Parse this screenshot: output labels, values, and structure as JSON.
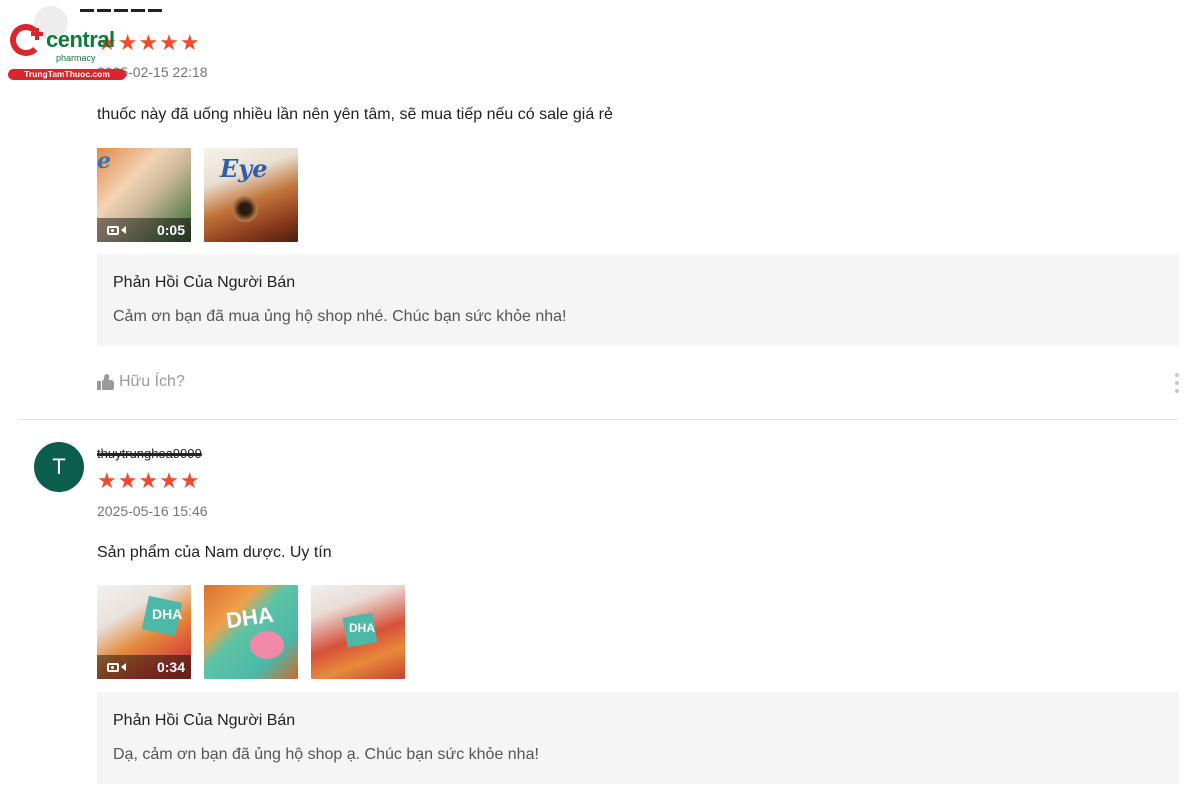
{
  "brand": {
    "name": "central",
    "tagline": "pharmacy",
    "site": "TrungTamThuoc.com",
    "red": "#d9252b",
    "green": "#0f7a3a"
  },
  "colors": {
    "star": "#ee4d2d",
    "reply_bg": "#f5f5f5",
    "avatar_bg": "#0b5d4c"
  },
  "reviews": [
    {
      "username": "",
      "rating": 5,
      "stars": "★★★★★",
      "date": "2025-02-15 22:18",
      "comment": "thuốc này đã uống nhiều lần nên yên tâm, sẽ mua tiếp nếu có sale giá rẻ",
      "media": [
        {
          "kind": "video",
          "duration": "0:05"
        },
        {
          "kind": "image"
        }
      ],
      "reply": {
        "title": "Phản Hồi Của Người Bán",
        "text": "Cảm ơn bạn đã mua ủng hộ shop nhé. Chúc bạn sức khỏe nha!"
      },
      "helpful_label": "Hữu Ích?"
    },
    {
      "avatar_letter": "T",
      "username": "thuytrunghoa9999",
      "rating": 5,
      "stars": "★★★★★",
      "date": "2025-05-16 15:46",
      "comment": "Sản phẩm của Nam dược. Uy tín",
      "media": [
        {
          "kind": "video",
          "duration": "0:34"
        },
        {
          "kind": "image"
        },
        {
          "kind": "image"
        }
      ],
      "reply": {
        "title": "Phản Hồi Của Người Bán",
        "text": "Dạ, cảm ơn bạn đã ủng hộ shop ạ. Chúc bạn sức khỏe nha!"
      }
    }
  ]
}
